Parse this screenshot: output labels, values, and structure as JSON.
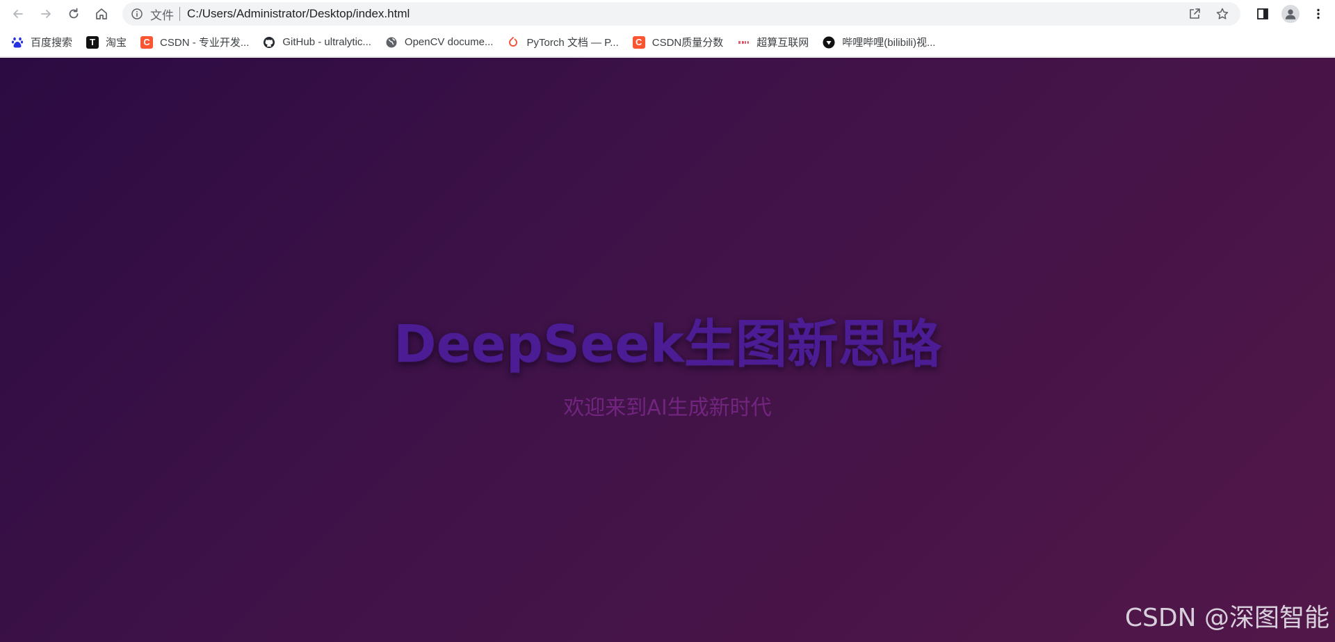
{
  "toolbar": {
    "back_icon": "arrow-left-icon",
    "forward_icon": "arrow-right-icon",
    "reload_icon": "reload-icon",
    "home_icon": "home-icon"
  },
  "omnibox": {
    "chip_label": "文件",
    "url": "C:/Users/Administrator/Desktop/index.html"
  },
  "bookmarks": [
    {
      "label": "百度搜索",
      "icon": "baidu-paw-icon",
      "color": "#2932e1"
    },
    {
      "label": "淘宝",
      "icon": "taobao-icon",
      "color": "#e8002d"
    },
    {
      "label": "CSDN - 专业开发...",
      "icon": "csdn-icon",
      "color": "#fc5531"
    },
    {
      "label": "GitHub - ultralytic...",
      "icon": "github-icon",
      "color": "#24292f"
    },
    {
      "label": "OpenCV docume...",
      "icon": "globe-icon",
      "color": "#5f6368"
    },
    {
      "label": "PyTorch 文档 — P...",
      "icon": "pytorch-icon",
      "color": "#ee4c2c"
    },
    {
      "label": "CSDN质量分数",
      "icon": "csdn-icon",
      "color": "#fc5531"
    },
    {
      "label": "超算互联网",
      "icon": "scnet-icon",
      "color": "#d3001b"
    },
    {
      "label": "哔哩哔哩(bilibili)视...",
      "icon": "bilibili-icon",
      "color": "#111111"
    }
  ],
  "page": {
    "title": "DeepSeek生图新思路",
    "subtitle": "欢迎来到AI生成新时代",
    "watermark": "CSDN @深图智能"
  },
  "colors": {
    "bg_start": "#2b0b42",
    "bg_end": "#521749",
    "title": "#4b1c94",
    "subtitle": "#72257f"
  }
}
